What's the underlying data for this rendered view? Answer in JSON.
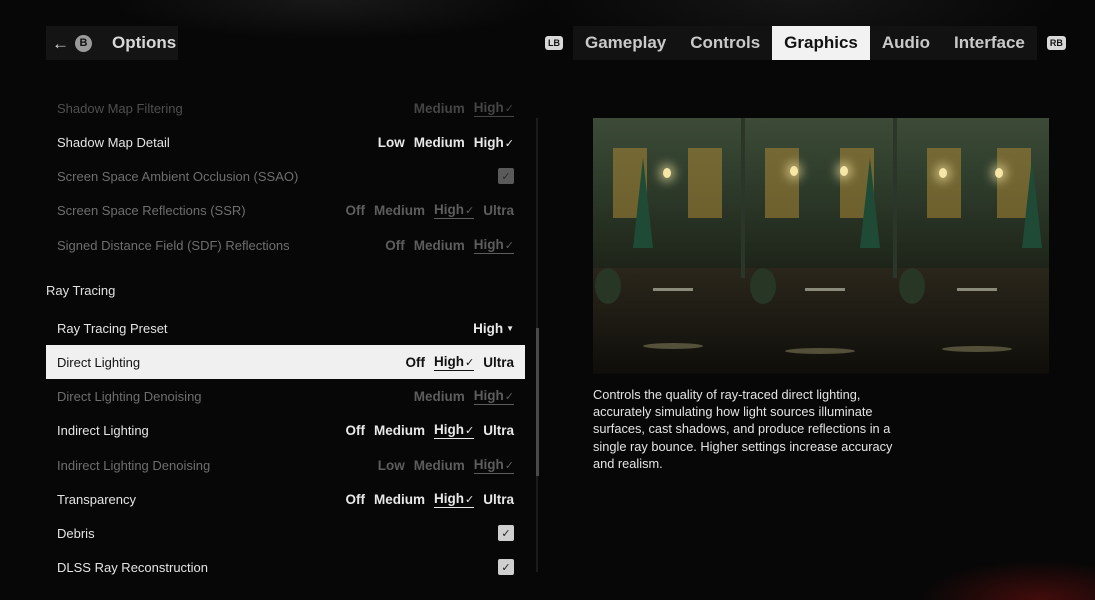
{
  "header": {
    "back_button_glyph": "B",
    "title": "Options",
    "left_bumper": "LB",
    "right_bumper": "RB",
    "tabs": [
      {
        "label": "Gameplay",
        "active": false
      },
      {
        "label": "Controls",
        "active": false
      },
      {
        "label": "Graphics",
        "active": true
      },
      {
        "label": "Audio",
        "active": false
      },
      {
        "label": "Interface",
        "active": false
      }
    ]
  },
  "settings": {
    "shadow_map_filtering": {
      "label": "Shadow Map Filtering",
      "options": [
        "Medium",
        "High"
      ],
      "selected": "High"
    },
    "shadow_map_detail": {
      "label": "Shadow Map Detail",
      "options": [
        "Low",
        "Medium",
        "High"
      ],
      "selected": "High"
    },
    "ssao": {
      "label": "Screen Space Ambient Occlusion (SSAO)",
      "checked": true
    },
    "ssr": {
      "label": "Screen Space Reflections (SSR)",
      "options": [
        "Off",
        "Medium",
        "High",
        "Ultra"
      ],
      "selected": "High"
    },
    "sdf": {
      "label": "Signed Distance Field (SDF) Reflections",
      "options": [
        "Off",
        "Medium",
        "High"
      ],
      "selected": "High"
    },
    "ray_tracing_section": "Ray Tracing",
    "rt_preset": {
      "label": "Ray Tracing Preset",
      "value": "High"
    },
    "direct_lighting": {
      "label": "Direct Lighting",
      "options": [
        "Off",
        "High",
        "Ultra"
      ],
      "selected": "High"
    },
    "direct_lighting_denoising": {
      "label": "Direct Lighting Denoising",
      "options": [
        "Medium",
        "High"
      ],
      "selected": "High"
    },
    "indirect_lighting": {
      "label": "Indirect Lighting",
      "options": [
        "Off",
        "Medium",
        "High",
        "Ultra"
      ],
      "selected": "High"
    },
    "indirect_lighting_denoising": {
      "label": "Indirect Lighting Denoising",
      "options": [
        "Low",
        "Medium",
        "High"
      ],
      "selected": "High"
    },
    "transparency": {
      "label": "Transparency",
      "options": [
        "Off",
        "Medium",
        "High",
        "Ultra"
      ],
      "selected": "High"
    },
    "debris": {
      "label": "Debris",
      "checked": true
    },
    "dlss_rr": {
      "label": "DLSS Ray Reconstruction",
      "checked": true
    }
  },
  "description": "Controls the quality of ray-traced direct lighting, accurately simulating how light sources illuminate surfaces, cast shadows, and produce reflections in a single ray bounce. Higher settings increase accuracy and realism.",
  "colors": {
    "selected_row_bg": "#f0f0f0",
    "active_tab_bg": "#f2f2f2",
    "background": "#070707"
  }
}
